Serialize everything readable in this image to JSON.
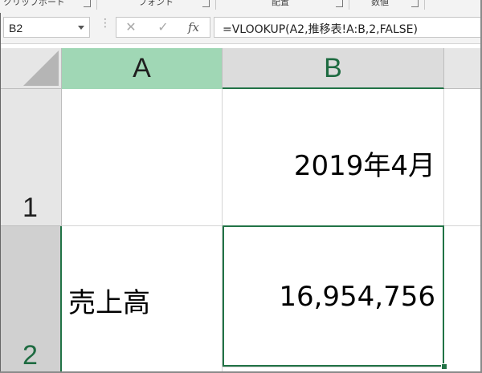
{
  "ribbon": {
    "groups": [
      "クリップボード",
      "フォント",
      "配置",
      "数値"
    ]
  },
  "formula_bar": {
    "name_box": "B2",
    "cancel_glyph": "✕",
    "enter_glyph": "✓",
    "fx_label": "fx",
    "formula": "=VLOOKUP(A2,推移表!A:B,2,FALSE)"
  },
  "grid": {
    "columns": [
      "A",
      "B"
    ],
    "rows": [
      "1",
      "2"
    ],
    "cells": {
      "A1": "",
      "B1": "2019年4月",
      "A2": "売上高",
      "B2": "16,954,756"
    },
    "selected_cell": "B2",
    "accent_color": "#217346",
    "selected_col_header_color": "#a0d7b5"
  }
}
